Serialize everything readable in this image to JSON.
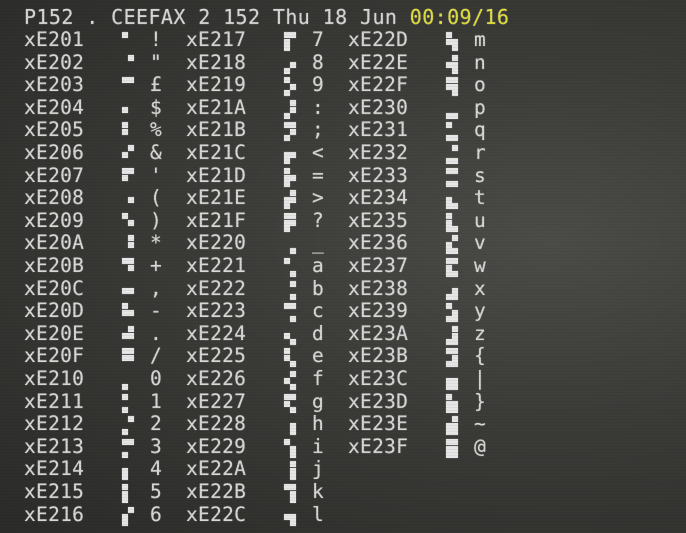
{
  "header": {
    "page": "P152",
    "dot": ".",
    "service": "CEEFAX 2",
    "page_number": "152",
    "day": "Thu",
    "date": "18",
    "month": "Jun",
    "time": "00:09/16"
  },
  "colors": {
    "text": "#d7d7d7",
    "clock": "#e1de3a",
    "background": "#3b3b38"
  },
  "columns": [
    [
      {
        "code": "xE201",
        "char": "!",
        "mosaic": 1
      },
      {
        "code": "xE202",
        "char": "\"",
        "mosaic": 2
      },
      {
        "code": "xE203",
        "char": "£",
        "mosaic": 3
      },
      {
        "code": "xE204",
        "char": "$",
        "mosaic": 4
      },
      {
        "code": "xE205",
        "char": "%",
        "mosaic": 5
      },
      {
        "code": "xE206",
        "char": "&",
        "mosaic": 6
      },
      {
        "code": "xE207",
        "char": "'",
        "mosaic": 7
      },
      {
        "code": "xE208",
        "char": "(",
        "mosaic": 8
      },
      {
        "code": "xE209",
        "char": ")",
        "mosaic": 9
      },
      {
        "code": "xE20A",
        "char": "*",
        "mosaic": 10
      },
      {
        "code": "xE20B",
        "char": "+",
        "mosaic": 11
      },
      {
        "code": "xE20C",
        "char": ",",
        "mosaic": 12
      },
      {
        "code": "xE20D",
        "char": "-",
        "mosaic": 13
      },
      {
        "code": "xE20E",
        "char": ".",
        "mosaic": 14
      },
      {
        "code": "xE20F",
        "char": "/",
        "mosaic": 15
      },
      {
        "code": "xE210",
        "char": "0",
        "mosaic": 16
      },
      {
        "code": "xE211",
        "char": "1",
        "mosaic": 17
      },
      {
        "code": "xE212",
        "char": "2",
        "mosaic": 18
      },
      {
        "code": "xE213",
        "char": "3",
        "mosaic": 19
      },
      {
        "code": "xE214",
        "char": "4",
        "mosaic": 20
      },
      {
        "code": "xE215",
        "char": "5",
        "mosaic": 21
      },
      {
        "code": "xE216",
        "char": "6",
        "mosaic": 22
      }
    ],
    [
      {
        "code": "xE217",
        "char": "7",
        "mosaic": 23
      },
      {
        "code": "xE218",
        "char": "8",
        "mosaic": 24
      },
      {
        "code": "xE219",
        "char": "9",
        "mosaic": 25
      },
      {
        "code": "xE21A",
        "char": ":",
        "mosaic": 26
      },
      {
        "code": "xE21B",
        "char": ";",
        "mosaic": 27
      },
      {
        "code": "xE21C",
        "char": "<",
        "mosaic": 28
      },
      {
        "code": "xE21D",
        "char": "=",
        "mosaic": 29
      },
      {
        "code": "xE21E",
        "char": ">",
        "mosaic": 30
      },
      {
        "code": "xE21F",
        "char": "?",
        "mosaic": 31
      },
      {
        "code": "xE220",
        "char": "_",
        "mosaic": 32
      },
      {
        "code": "xE221",
        "char": "a",
        "mosaic": 33
      },
      {
        "code": "xE222",
        "char": "b",
        "mosaic": 34
      },
      {
        "code": "xE223",
        "char": "c",
        "mosaic": 35
      },
      {
        "code": "xE224",
        "char": "d",
        "mosaic": 36
      },
      {
        "code": "xE225",
        "char": "e",
        "mosaic": 37
      },
      {
        "code": "xE226",
        "char": "f",
        "mosaic": 38
      },
      {
        "code": "xE227",
        "char": "g",
        "mosaic": 39
      },
      {
        "code": "xE228",
        "char": "h",
        "mosaic": 40
      },
      {
        "code": "xE229",
        "char": "i",
        "mosaic": 41
      },
      {
        "code": "xE22A",
        "char": "j",
        "mosaic": 42
      },
      {
        "code": "xE22B",
        "char": "k",
        "mosaic": 43
      },
      {
        "code": "xE22C",
        "char": "l",
        "mosaic": 44
      }
    ],
    [
      {
        "code": "xE22D",
        "char": "m",
        "mosaic": 45
      },
      {
        "code": "xE22E",
        "char": "n",
        "mosaic": 46
      },
      {
        "code": "xE22F",
        "char": "o",
        "mosaic": 47
      },
      {
        "code": "xE230",
        "char": "p",
        "mosaic": 48
      },
      {
        "code": "xE231",
        "char": "q",
        "mosaic": 49
      },
      {
        "code": "xE232",
        "char": "r",
        "mosaic": 50
      },
      {
        "code": "xE233",
        "char": "s",
        "mosaic": 51
      },
      {
        "code": "xE234",
        "char": "t",
        "mosaic": 52
      },
      {
        "code": "xE235",
        "char": "u",
        "mosaic": 53
      },
      {
        "code": "xE236",
        "char": "v",
        "mosaic": 54
      },
      {
        "code": "xE237",
        "char": "w",
        "mosaic": 55
      },
      {
        "code": "xE238",
        "char": "x",
        "mosaic": 56
      },
      {
        "code": "xE239",
        "char": "y",
        "mosaic": 57
      },
      {
        "code": "xE23A",
        "char": "z",
        "mosaic": 58
      },
      {
        "code": "xE23B",
        "char": "{",
        "mosaic": 59
      },
      {
        "code": "xE23C",
        "char": "|",
        "mosaic": 60
      },
      {
        "code": "xE23D",
        "char": "}",
        "mosaic": 61
      },
      {
        "code": "xE23E",
        "char": "~",
        "mosaic": 62
      },
      {
        "code": "xE23F",
        "char": "@",
        "mosaic": 63
      }
    ]
  ]
}
